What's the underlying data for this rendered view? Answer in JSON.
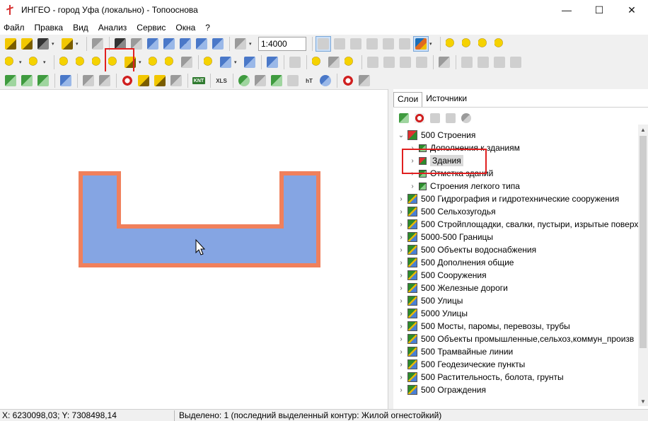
{
  "window": {
    "title": "ИНГЕО - город Уфа (локально) - Топооснова",
    "minimize": "—",
    "maximize": "☐",
    "close": "✕"
  },
  "menu": [
    "Файл",
    "Правка",
    "Вид",
    "Анализ",
    "Сервис",
    "Окна",
    "?"
  ],
  "toolbar": {
    "scale_value": "1:4000",
    "xls_label": "XLS",
    "knt_label": "KNT",
    "dropdown_glyph": "▾"
  },
  "panel": {
    "tabs": [
      "Слои",
      "Источники"
    ],
    "tree": [
      {
        "label": "500 Строения",
        "expanded": true,
        "level": 0
      },
      {
        "label": "Дополнения к зданиям",
        "level": 1
      },
      {
        "label": "Здания",
        "level": 1,
        "selected": true
      },
      {
        "label": "Отметка зданий",
        "level": 1
      },
      {
        "label": "Строения легкого типа",
        "level": 1
      },
      {
        "label": "500 Гидрография и гидротехнические сооружения",
        "level": 0
      },
      {
        "label": "500 Сельхозугодья",
        "level": 0
      },
      {
        "label": "500 Стройплощадки, свалки, пустыри, изрытые поверх",
        "level": 0
      },
      {
        "label": "5000-500 Границы",
        "level": 0
      },
      {
        "label": "500 Объекты водоснабжения",
        "level": 0
      },
      {
        "label": "500 Дополнения общие",
        "level": 0
      },
      {
        "label": "500 Сооружения",
        "level": 0
      },
      {
        "label": "500 Железные дороги",
        "level": 0
      },
      {
        "label": "500 Улицы",
        "level": 0
      },
      {
        "label": "5000 Улицы",
        "level": 0
      },
      {
        "label": "500 Мосты, паромы, перевозы, трубы",
        "level": 0
      },
      {
        "label": "500 Объекты промышленные,сельхоз,коммун_произв",
        "level": 0
      },
      {
        "label": "500 Трамвайные линии",
        "level": 0
      },
      {
        "label": "500 Геодезические пункты",
        "level": 0
      },
      {
        "label": "500 Растительность, болота, грунты",
        "level": 0
      },
      {
        "label": "500 Ограждения",
        "level": 0
      }
    ],
    "chevron_collapsed": "›",
    "chevron_expanded": "⌄"
  },
  "status": {
    "coords": "X: 6230098,03; Y: 7308498,14",
    "message": "Выделено: 1 (последний выделенный контур: Жилой огнестойкий)"
  },
  "colors": {
    "building_fill": "#85a5e3",
    "building_outline": "#f0805c",
    "highlight": "#e02020"
  }
}
